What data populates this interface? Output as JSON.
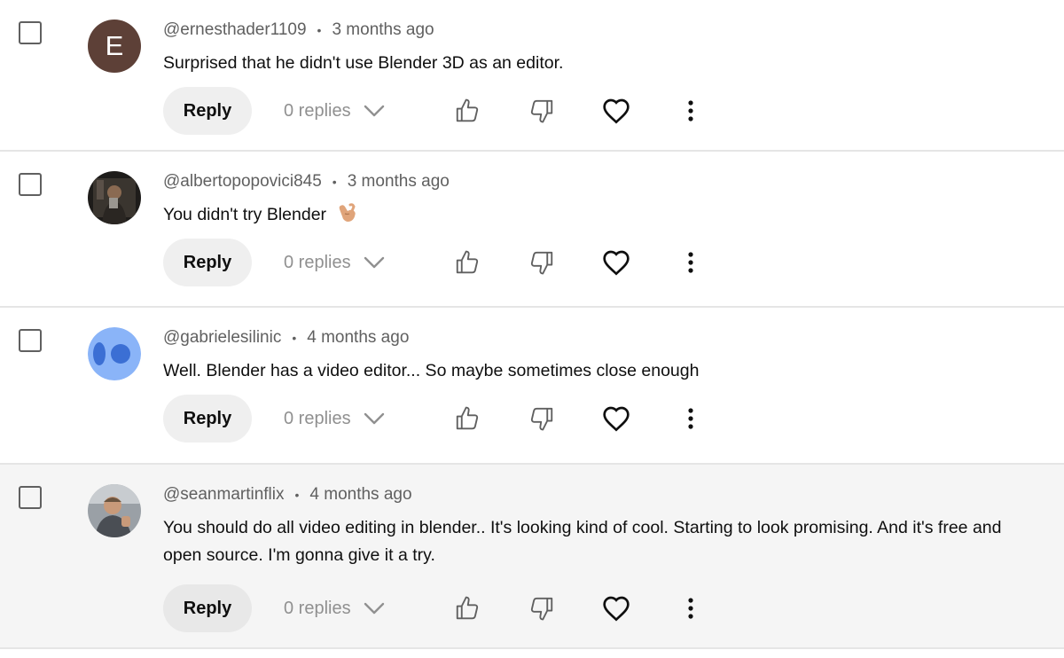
{
  "comments": [
    {
      "author": "@ernesthader1109",
      "age": "3 months ago",
      "text": "Surprised that he didn't use Blender 3D as an editor.",
      "avatar_letter": "E",
      "reply_label": "Reply",
      "replies_label": "0 replies"
    },
    {
      "author": "@albertopopovici845",
      "age": "3 months ago",
      "text": "You didn't try Blender",
      "reply_label": "Reply",
      "replies_label": "0 replies"
    },
    {
      "author": "@gabrielesilinic",
      "age": "4 months ago",
      "text": "Well. Blender has a video editor... So maybe sometimes close enough",
      "reply_label": "Reply",
      "replies_label": "0 replies"
    },
    {
      "author": "@seanmartinflix",
      "age": "4 months ago",
      "text": "You should do all video editing in blender.. It's looking kind of cool. Starting to look promising. And it's free and open source. I'm gonna give it a try.",
      "reply_label": "Reply",
      "replies_label": "0 replies"
    }
  ],
  "colors": {
    "secondary_text": "#606060",
    "divider": "#e5e5e5",
    "reply_button_bg": "#efefef",
    "highlight_row_bg": "#f5f5f5",
    "avatar_letter_bg": "#5d4037",
    "avatar_blue_bg": "#8ab4f8",
    "avatar_blue_fg": "#3b6fd4"
  },
  "icons": [
    "thumbs-up-icon",
    "thumbs-down-icon",
    "heart-icon",
    "more-vert-icon",
    "chevron-down-icon",
    "call-me-hand-emoji"
  ]
}
